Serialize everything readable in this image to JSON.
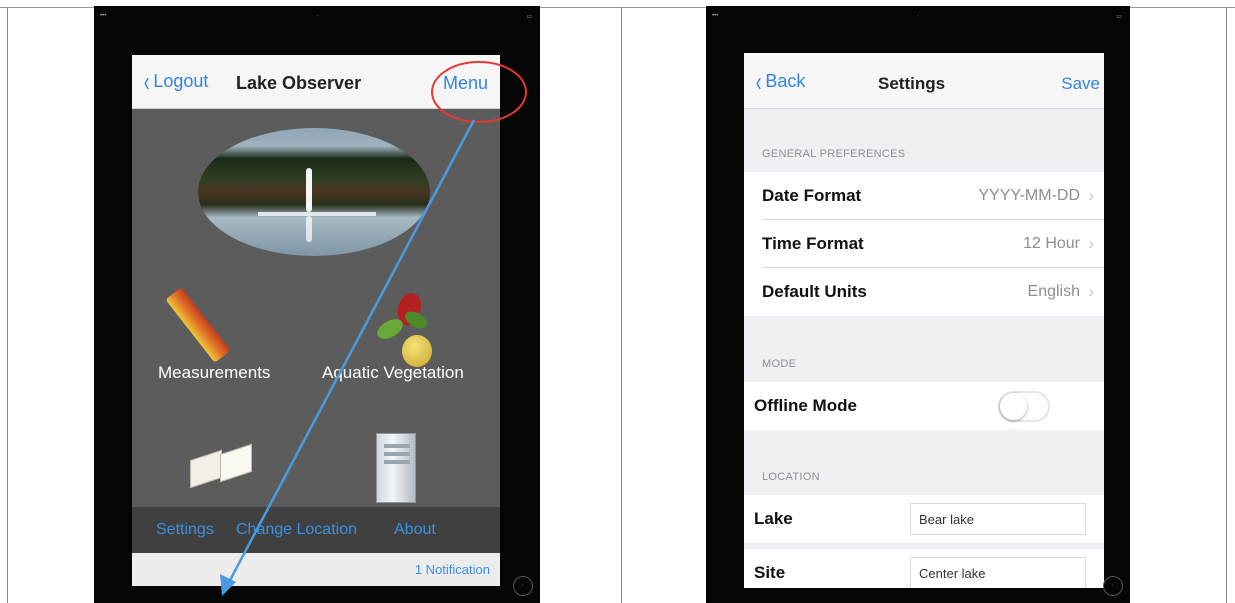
{
  "left_screen": {
    "nav": {
      "back_label": "Logout",
      "title": "Lake Observer",
      "menu_label": "Menu"
    },
    "tiles": [
      {
        "label": "Measurements",
        "icon": "ruler-icon"
      },
      {
        "label": "Aquatic Vegetation",
        "icon": "plant-icon"
      },
      {
        "label": "",
        "icon": "book-icon"
      },
      {
        "label": "",
        "icon": "server-icon"
      }
    ],
    "links": {
      "settings": "Settings",
      "change_location": "Change Location",
      "about": "About"
    },
    "notification": "1 Notification",
    "annotation_color": "#e53935",
    "arrow_color": "#4a9be0"
  },
  "right_screen": {
    "nav": {
      "back_label": "Back",
      "title": "Settings",
      "save_label": "Save"
    },
    "sections": {
      "general": "GENERAL PREFERENCES",
      "mode": "MODE",
      "location": "LOCATION"
    },
    "rows": {
      "date_format": {
        "label": "Date Format",
        "value": "YYYY-MM-DD"
      },
      "time_format": {
        "label": "Time Format",
        "value": "12 Hour"
      },
      "default_units": {
        "label": "Default Units",
        "value": "English"
      },
      "offline_mode": {
        "label": "Offline Mode",
        "enabled": false
      },
      "lake": {
        "label": "Lake",
        "value": "Bear lake"
      },
      "site": {
        "label": "Site",
        "value": "Center lake"
      }
    }
  },
  "colors": {
    "ios_blue": "#2f86e6",
    "dark_bg": "#5c5c5c",
    "grouped_bg": "#efeff4"
  }
}
